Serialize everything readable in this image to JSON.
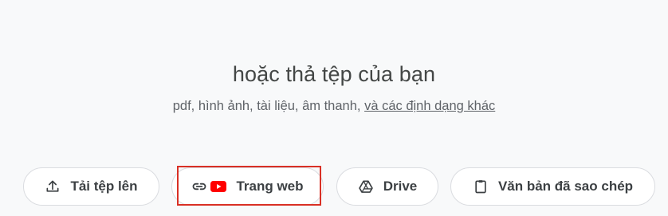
{
  "dropzone": {
    "headline": "hoặc thả tệp của bạn",
    "formats_prefix": "pdf, hình ảnh, tài liệu, âm thanh, ",
    "formats_link": "và các định dạng khác"
  },
  "sources": {
    "upload": {
      "label": "Tải tệp lên",
      "icon": "upload-icon"
    },
    "website": {
      "label": "Trang web",
      "icons": [
        "link-icon",
        "youtube-icon"
      ]
    },
    "drive": {
      "label": "Drive",
      "icon": "drive-icon"
    },
    "clipboard": {
      "label": "Văn bản đã sao chép",
      "icon": "clipboard-icon"
    }
  },
  "colors": {
    "background": "#f8f9fa",
    "button_border": "#dadce0",
    "youtube_red": "#ff0000",
    "highlight": "#d93025"
  }
}
